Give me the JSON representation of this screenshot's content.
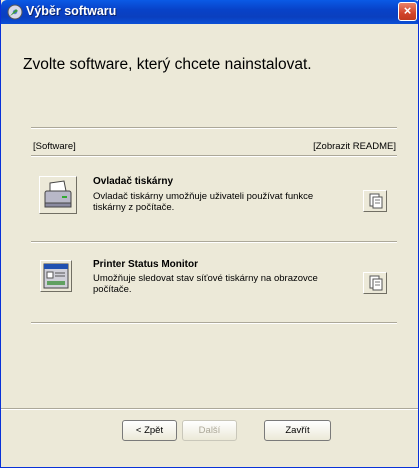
{
  "window": {
    "title": "Výběr softwaru",
    "close_glyph": "×"
  },
  "heading": "Zvolte software, který chcete nainstalovat.",
  "columns": {
    "left": "[Software]",
    "right": "[Zobrazit README]"
  },
  "items": [
    {
      "name": "Ovladač tiskárny",
      "description": "Ovladač tiskárny umožňuje uživateli používat funkce tiskárny z počítače.",
      "icon": "printer-icon"
    },
    {
      "name": "Printer Status Monitor",
      "description": "Umožňuje sledovat stav síťové tiskárny na obrazovce počítače.",
      "icon": "status-monitor-icon"
    }
  ],
  "buttons": {
    "back": "< Zpět",
    "next": "Další",
    "close": "Zavřít"
  },
  "colors": {
    "titlebar": "#0a4fd6",
    "face": "#ece9d8",
    "close": "#d2442a"
  }
}
